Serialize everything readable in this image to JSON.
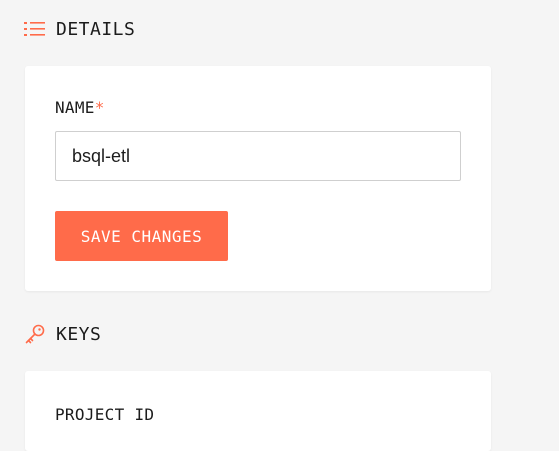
{
  "accent_color": "#ff6b4a",
  "details": {
    "icon": "list-icon",
    "title": "DETAILS",
    "name_label": "NAME",
    "required_marker": "*",
    "name_value": "bsql-etl",
    "save_label": "SAVE CHANGES"
  },
  "keys": {
    "icon": "key-icon",
    "title": "KEYS",
    "project_id_label": "PROJECT ID"
  }
}
